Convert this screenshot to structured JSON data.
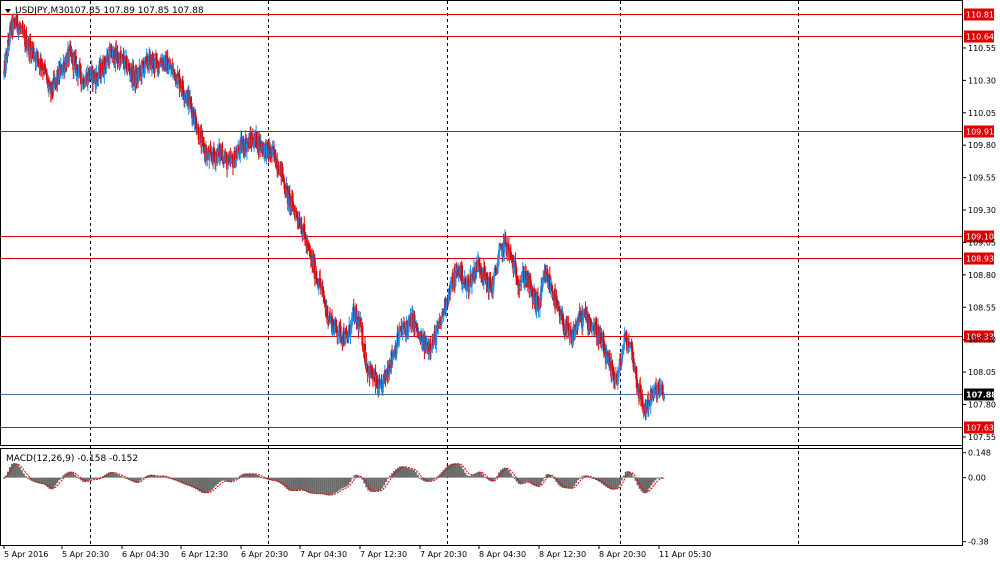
{
  "chart_data": {
    "type": "candlestick",
    "symbol_title": "USDJPY,M30",
    "ohlc_text": "107.85 107.89 107.85 107.88",
    "current_price": 107.88,
    "price_ylim": [
      107.48,
      110.92
    ],
    "price_ticks": [
      "110.55",
      "110.30",
      "110.05",
      "109.80",
      "109.55",
      "109.30",
      "109.05",
      "108.80",
      "108.55",
      "108.30",
      "108.05",
      "107.80",
      "107.55"
    ],
    "horizontal_levels": [
      110.81,
      110.64,
      109.91,
      109.1,
      108.93,
      108.33,
      107.63
    ],
    "horizontal_level_labels": [
      "110.81",
      "110.64",
      "109.91",
      "109.10",
      "108.93",
      "108.33",
      "107.63"
    ],
    "current_price_label": "107.88",
    "time_labels": [
      "5 Apr 2016",
      "5 Apr 20:30",
      "6 Apr 04:30",
      "6 Apr 12:30",
      "6 Apr 20:30",
      "7 Apr 04:30",
      "7 Apr 12:30",
      "7 Apr 20:30",
      "8 Apr 04:30",
      "8 Apr 12:30",
      "8 Apr 20:30",
      "11 Apr 05:30"
    ],
    "macd": {
      "label": "MACD(12,26,9) -0.158 -0.152",
      "ylim": [
        -0.4,
        0.17
      ],
      "ticks": [
        "0.148",
        "0.00",
        "-0.38"
      ]
    },
    "series": {
      "close_path": [
        110.35,
        110.7,
        110.75,
        110.62,
        110.55,
        110.48,
        110.4,
        110.2,
        110.3,
        110.42,
        110.5,
        110.4,
        110.3,
        110.35,
        110.32,
        110.4,
        110.5,
        110.48,
        110.45,
        110.38,
        110.3,
        110.4,
        110.45,
        110.42,
        110.46,
        110.4,
        110.35,
        110.25,
        110.15,
        110.0,
        109.8,
        109.7,
        109.72,
        109.75,
        109.65,
        109.7,
        109.8,
        109.82,
        109.85,
        109.8,
        109.75,
        109.72,
        109.6,
        109.4,
        109.3,
        109.2,
        109.0,
        108.85,
        108.7,
        108.5,
        108.4,
        108.35,
        108.3,
        108.5,
        108.4,
        108.1,
        108.0,
        107.9,
        108.05,
        108.2,
        108.35,
        108.4,
        108.45,
        108.3,
        108.25,
        108.28,
        108.4,
        108.6,
        108.75,
        108.85,
        108.7,
        108.8,
        108.9,
        108.75,
        108.7,
        108.95,
        109.05,
        108.9,
        108.75,
        108.8,
        108.65,
        108.55,
        108.8,
        108.7,
        108.5,
        108.4,
        108.3,
        108.45,
        108.48,
        108.42,
        108.35,
        108.2,
        108.05,
        108.0,
        108.3,
        108.25,
        107.95,
        107.75,
        107.85,
        107.92,
        107.88
      ]
    }
  }
}
